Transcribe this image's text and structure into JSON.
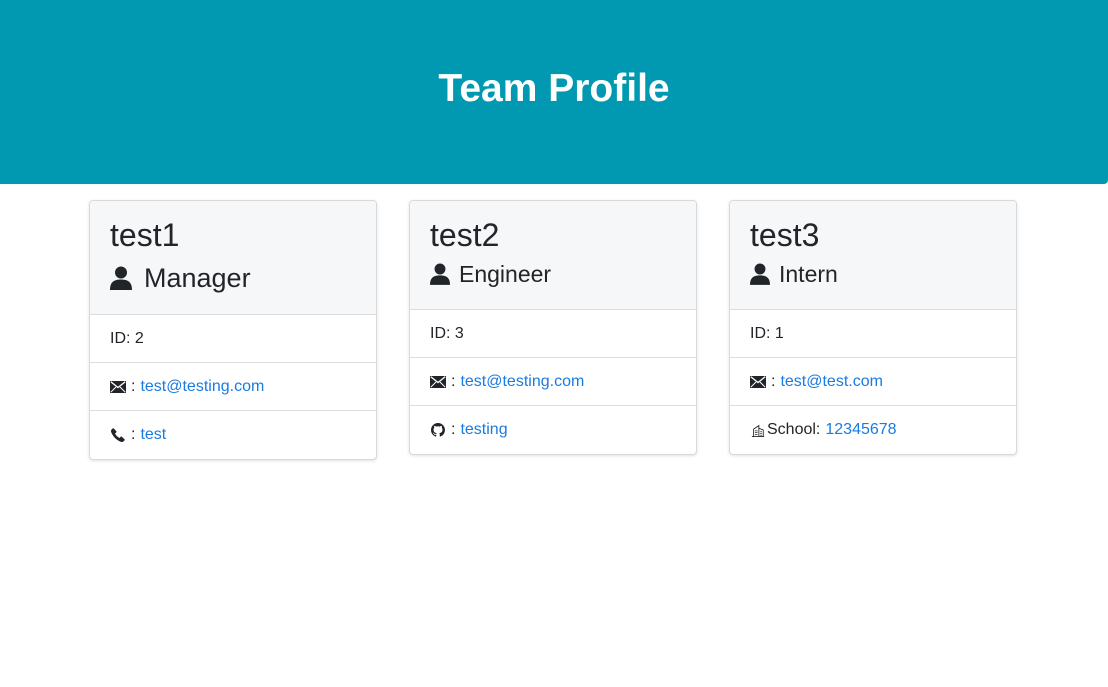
{
  "header": {
    "title": "Team Profile"
  },
  "cards": [
    {
      "name": "test1",
      "role": "Manager",
      "role_icon": "person-icon",
      "id_text": "ID: 2",
      "email": {
        "icon": "envelope-icon",
        "sep": ":",
        "value": "test@testing.com"
      },
      "extra": {
        "icon": "phone-icon",
        "label": ":",
        "value": "test"
      }
    },
    {
      "name": "test2",
      "role": "Engineer",
      "role_icon": "person-icon",
      "id_text": "ID: 3",
      "email": {
        "icon": "envelope-icon",
        "sep": ":",
        "value": "test@testing.com"
      },
      "extra": {
        "icon": "github-icon",
        "label": ":",
        "value": "testing"
      }
    },
    {
      "name": "test3",
      "role": "Intern",
      "role_icon": "person-icon",
      "id_text": "ID: 1",
      "email": {
        "icon": "envelope-icon",
        "sep": ":",
        "value": "test@test.com"
      },
      "extra": {
        "icon": "building-icon",
        "label": "School:",
        "value": "12345678"
      }
    }
  ],
  "colors": {
    "banner": "#0099b1",
    "link": "#1a7be0",
    "card_header": "#f6f7f8"
  }
}
